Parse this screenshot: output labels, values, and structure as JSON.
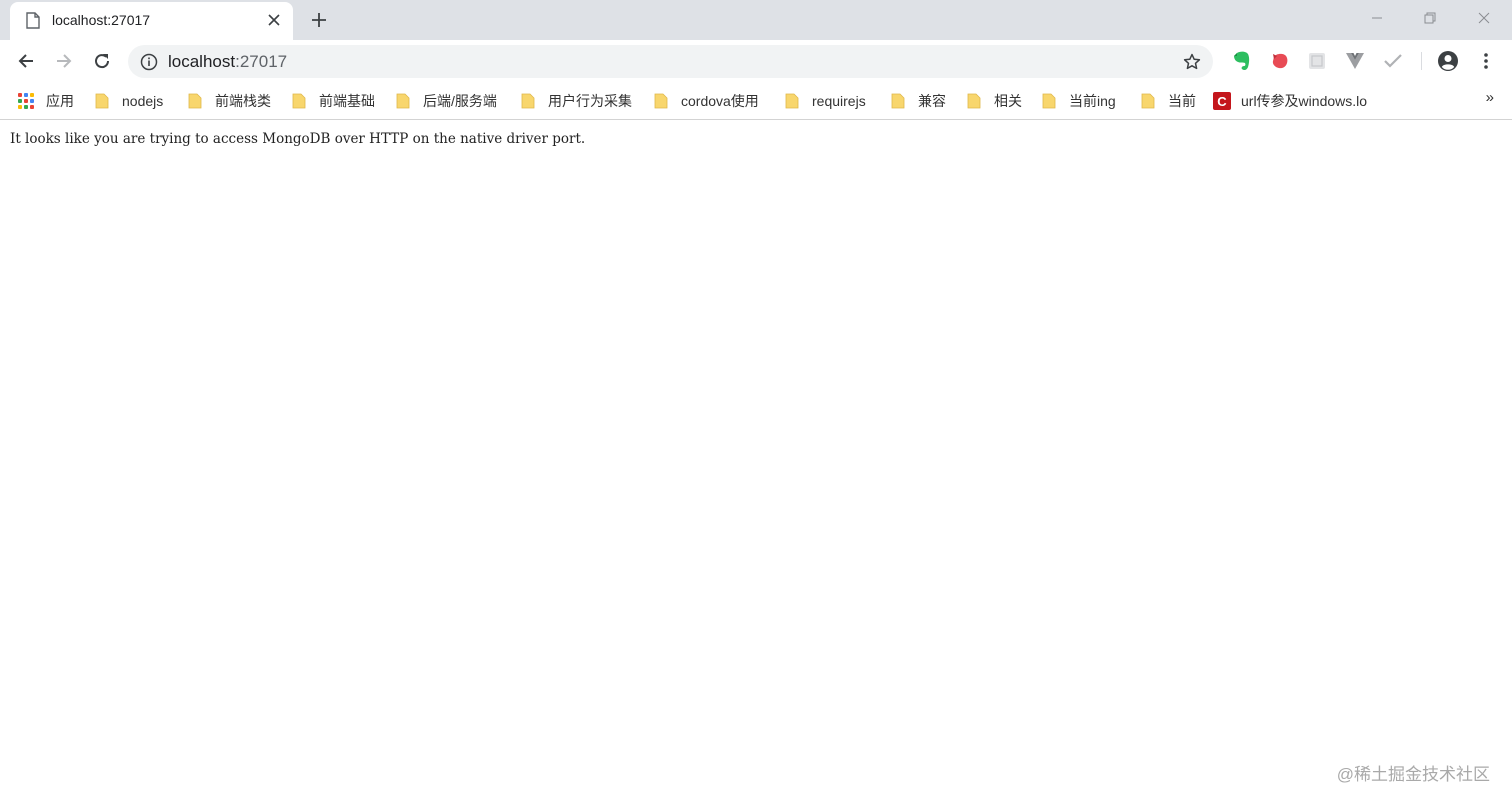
{
  "tab": {
    "title": "localhost:27017"
  },
  "address_bar": {
    "host": "localhost",
    "port": ":27017"
  },
  "bookmarks": [
    {
      "label": "应用",
      "type": "apps"
    },
    {
      "label": "nodejs",
      "type": "folder"
    },
    {
      "label": "前端栈类",
      "type": "folder"
    },
    {
      "label": "前端基础",
      "type": "folder"
    },
    {
      "label": "后端/服务端",
      "type": "folder"
    },
    {
      "label": "用户行为采集",
      "type": "folder"
    },
    {
      "label": "cordova使用",
      "type": "folder"
    },
    {
      "label": "requirejs",
      "type": "folder"
    },
    {
      "label": "兼容",
      "type": "folder"
    },
    {
      "label": "相关",
      "type": "folder"
    },
    {
      "label": "当前ing",
      "type": "folder"
    },
    {
      "label": "当前",
      "type": "folder"
    },
    {
      "label": "url传参及windows.lo",
      "type": "link"
    }
  ],
  "bookmarks_overflow": "»",
  "page": {
    "message": "It looks like you are trying to access MongoDB over HTTP on the native driver port."
  },
  "watermark": "@稀土掘金技术社区",
  "colors": {
    "tabstrip": "#dee1e6",
    "omnibox": "#f1f3f4",
    "folder": "#f8d66d",
    "evernote": "#2dbe60"
  },
  "icons": {
    "tab": "page-icon",
    "close": "close-icon",
    "new_tab": "plus-icon",
    "back": "back-arrow-icon",
    "forward": "forward-arrow-icon",
    "reload": "reload-icon",
    "info": "info-icon",
    "bookmark": "star-icon",
    "extensions": [
      "evernote-icon",
      "red-blob-icon",
      "grey-square-icon",
      "vue-devtools-icon",
      "checkmark-icon"
    ],
    "profile": "account-icon",
    "menu": "kebab-menu-icon"
  }
}
